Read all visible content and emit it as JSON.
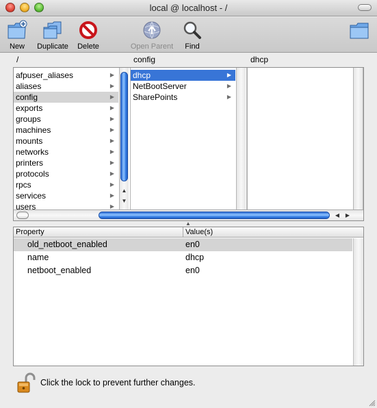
{
  "window": {
    "title": "local @ localhost - /"
  },
  "toolbar": {
    "new_label": "New",
    "duplicate_label": "Duplicate",
    "delete_label": "Delete",
    "open_parent_label": "Open Parent",
    "find_label": "Find"
  },
  "browser": {
    "columns": [
      {
        "header": "/",
        "items": [
          {
            "label": "afpuser_aliases"
          },
          {
            "label": "aliases"
          },
          {
            "label": "config"
          },
          {
            "label": "exports"
          },
          {
            "label": "groups"
          },
          {
            "label": "machines"
          },
          {
            "label": "mounts"
          },
          {
            "label": "networks"
          },
          {
            "label": "printers"
          },
          {
            "label": "protocols"
          },
          {
            "label": "rpcs"
          },
          {
            "label": "services"
          },
          {
            "label": "users"
          }
        ],
        "selected": "config"
      },
      {
        "header": "config",
        "items": [
          {
            "label": "dhcp"
          },
          {
            "label": "NetBootServer"
          },
          {
            "label": "SharePoints"
          }
        ],
        "selected": "dhcp"
      },
      {
        "header": "dhcp",
        "items": []
      }
    ]
  },
  "properties": {
    "headers": {
      "property": "Property",
      "values": "Value(s)"
    },
    "rows": [
      {
        "property": "old_netboot_enabled",
        "value": "en0"
      },
      {
        "property": "name",
        "value": "dhcp"
      },
      {
        "property": "netboot_enabled",
        "value": "en0"
      }
    ]
  },
  "status": {
    "lock_message": "Click the lock to prevent further changes."
  },
  "colors": {
    "selection_blue": "#3875d7",
    "selection_gray": "#d4d4d4"
  }
}
